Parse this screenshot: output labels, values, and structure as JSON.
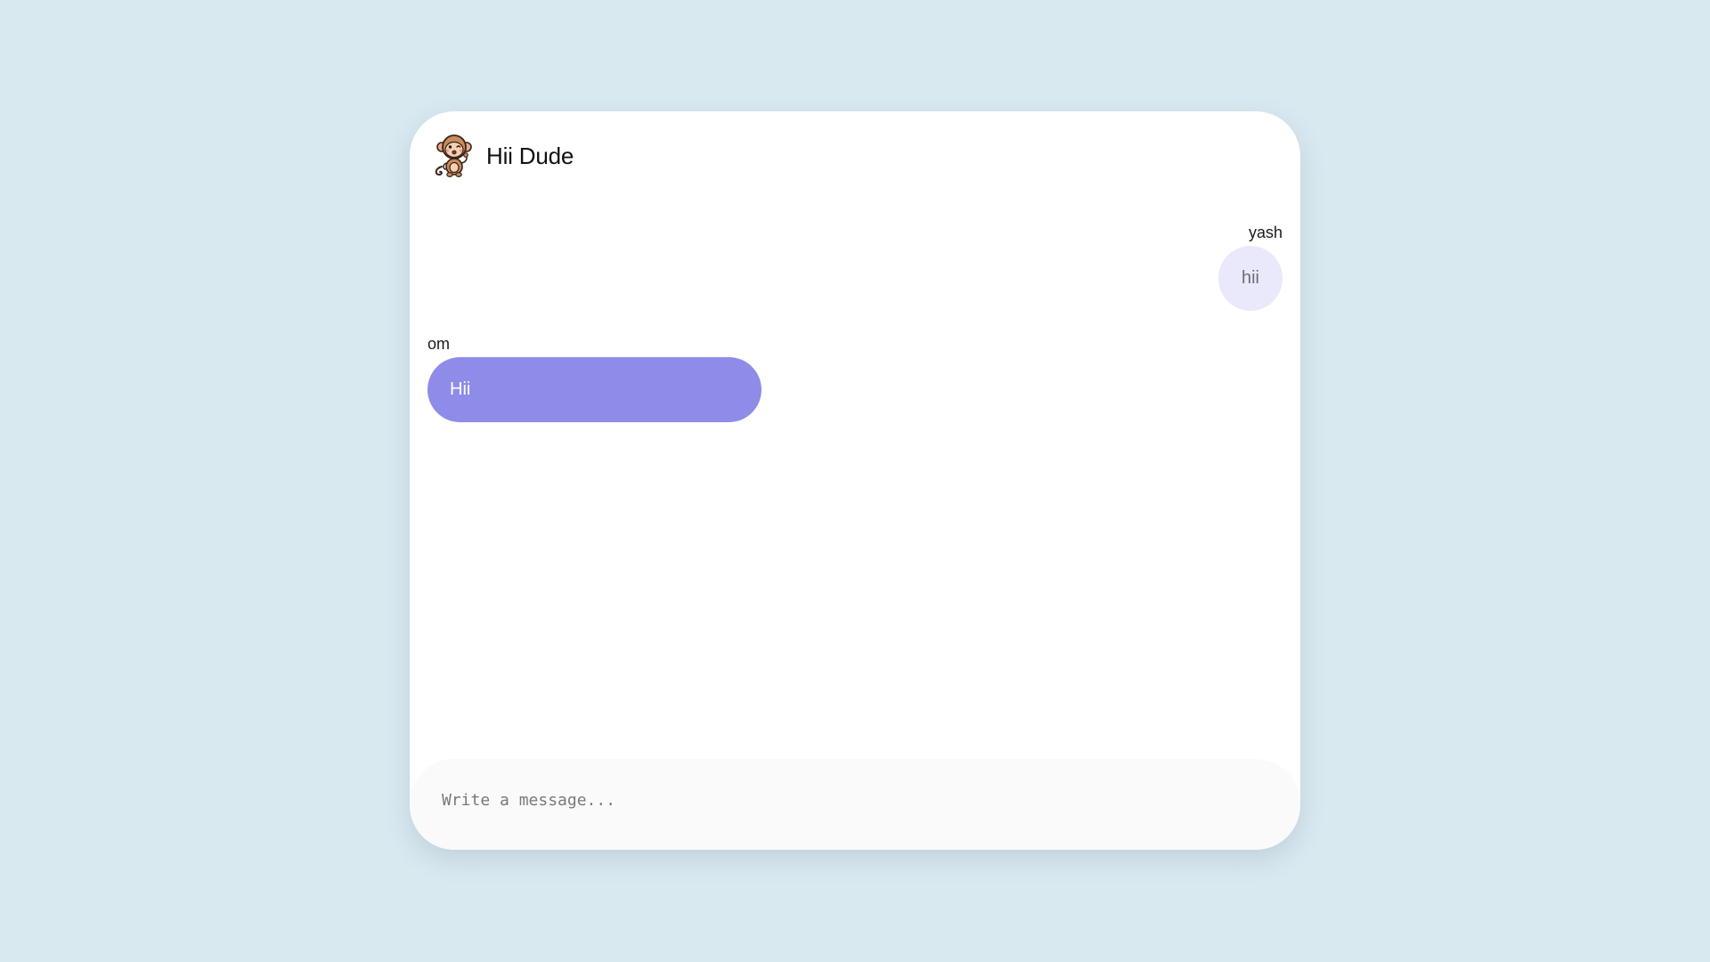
{
  "header": {
    "title": "Hii Dude",
    "avatar_icon": "monkey-icon"
  },
  "messages": [
    {
      "sender": "yash",
      "text": "hii",
      "direction": "outgoing"
    },
    {
      "sender": "om",
      "text": "Hii",
      "direction": "incoming"
    }
  ],
  "composer": {
    "placeholder": "Write a message...",
    "value": ""
  },
  "colors": {
    "page_background": "#d9e9f0",
    "card_background": "#ffffff",
    "incoming_bubble": "#8f8be8",
    "outgoing_bubble": "#e9e9fb",
    "composer_background": "#fafafa"
  }
}
